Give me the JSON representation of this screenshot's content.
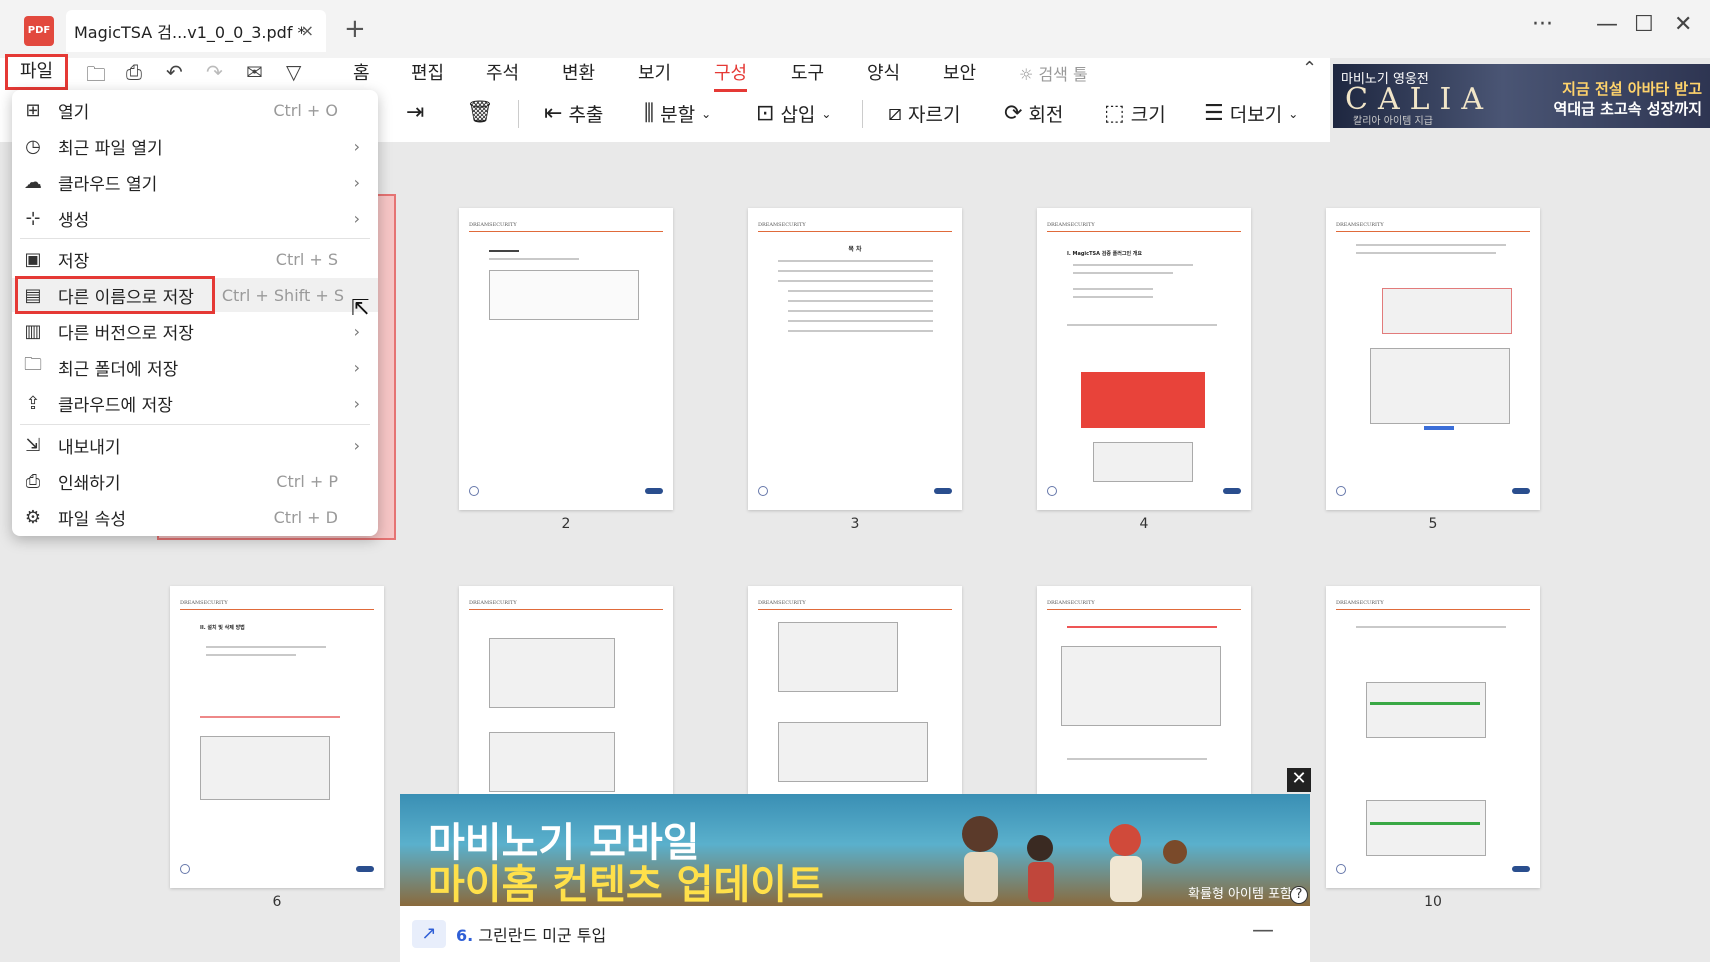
{
  "window": {
    "app_icon": "PDF",
    "tab_title": "MagicTSA 검...v1_0_0_3.pdf *",
    "tab_close": "×",
    "new_tab": "+",
    "more": "···",
    "minimize": "—",
    "maximize": "☐",
    "close": "✕"
  },
  "menubar": {
    "file_label": "파일",
    "tabs": [
      "홈",
      "편집",
      "주석",
      "변환",
      "보기",
      "구성",
      "도구",
      "양식",
      "보안"
    ],
    "active_tab": "구성",
    "search_label": "검색 툴"
  },
  "toolbar": {
    "extract": "추출",
    "split": "분할",
    "insert": "삽입",
    "crop": "자르기",
    "rotate": "회전",
    "size": "크기",
    "more": "더보기"
  },
  "file_menu": {
    "items": [
      {
        "label": "열기",
        "shortcut": "Ctrl + O",
        "arrow": ""
      },
      {
        "label": "최근 파일 열기",
        "shortcut": "",
        "arrow": "›"
      },
      {
        "label": "클라우드 열기",
        "shortcut": "",
        "arrow": "›"
      },
      {
        "label": "생성",
        "shortcut": "",
        "arrow": "›"
      },
      {
        "label": "저장",
        "shortcut": "Ctrl + S",
        "arrow": ""
      },
      {
        "label": "다른 이름으로 저장",
        "shortcut": "Ctrl + Shift + S",
        "arrow": ""
      },
      {
        "label": "다른 버전으로 저장",
        "shortcut": "",
        "arrow": "›"
      },
      {
        "label": "최근 폴더에 저장",
        "shortcut": "",
        "arrow": "›"
      },
      {
        "label": "클라우드에 저장",
        "shortcut": "",
        "arrow": "›"
      },
      {
        "label": "내보내기",
        "shortcut": "",
        "arrow": "›"
      },
      {
        "label": "인쇄하기",
        "shortcut": "Ctrl + P",
        "arrow": ""
      },
      {
        "label": "파일 속성",
        "shortcut": "Ctrl + D",
        "arrow": ""
      }
    ],
    "highlighted": "다른 이름으로 저장"
  },
  "pages": {
    "numbers": [
      "2",
      "3",
      "4",
      "5",
      "6",
      "10"
    ],
    "brand": "DREAMSECURITY",
    "p3_title": "목 차",
    "p4_title": "I. MagicTSA 검증 플러그인 개요",
    "p6_title": "II. 설치 및 삭제 방법"
  },
  "ad_top": {
    "line1": "마비노기 영웅전",
    "logo": "CALIA",
    "line3": "칼리아 아이템 지급",
    "right1": "지금 전설 아바타 받고",
    "right2": "역대급 초고속 성장까지"
  },
  "ad_bottom": {
    "title1": "마비노기 모바일",
    "title2": "마이홈 컨텐츠 업데이트",
    "caption": "확률형 아이템 포함",
    "info": "?",
    "close": "✕",
    "news_number": "6.",
    "news_text": "그린란드 미군 투입",
    "collapse": "—"
  },
  "colors": {
    "accent": "#e53935",
    "link_blue": "#2f5fd6"
  }
}
